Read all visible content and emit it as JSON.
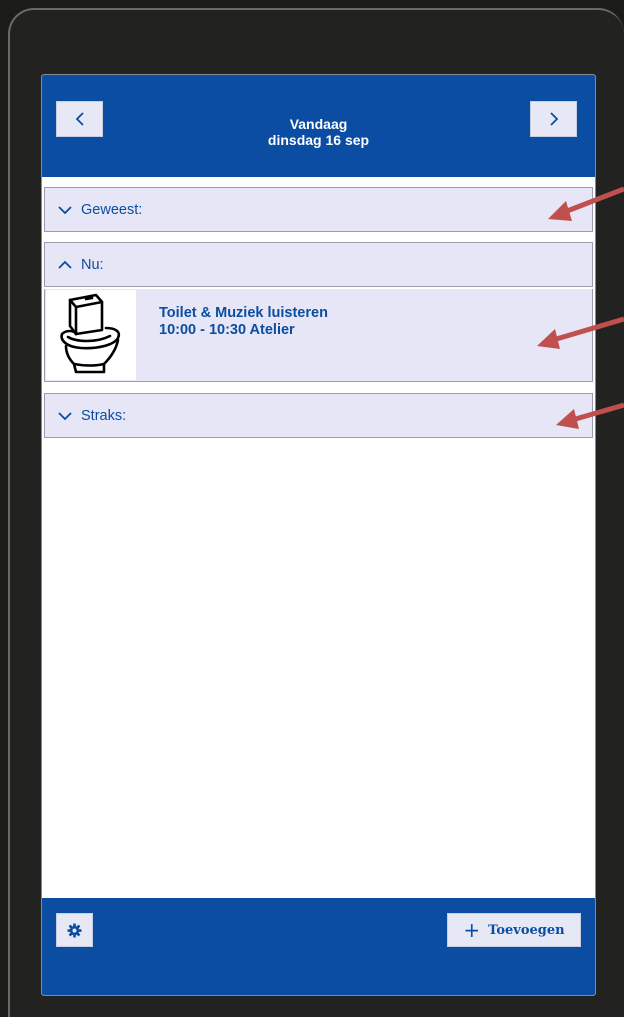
{
  "header": {
    "title": "Vandaag",
    "date": "dinsdag 16 sep",
    "prev_icon": "chevron-left-icon",
    "next_icon": "chevron-right-icon"
  },
  "sections": {
    "past": {
      "label": "Geweest:",
      "state": "collapsed"
    },
    "now": {
      "label": "Nu:",
      "state": "expanded"
    },
    "later": {
      "label": "Straks:",
      "state": "collapsed"
    }
  },
  "current_activity": {
    "name": "Toilet & Muziek luisteren",
    "time": "10:00 - 10:30 Atelier",
    "icon": "toilet-icon"
  },
  "footer": {
    "settings_icon": "gear-icon",
    "add_label": "Toevoegen",
    "add_icon": "plus-icon"
  },
  "annotations": {
    "arrow_icon": "red-arrow-icon",
    "count": 3
  },
  "colors": {
    "primary_blue": "#0b4da2",
    "section_bg": "#e6e6f6",
    "button_bg": "#e6e8f5",
    "annotation_red": "#c0504d"
  }
}
